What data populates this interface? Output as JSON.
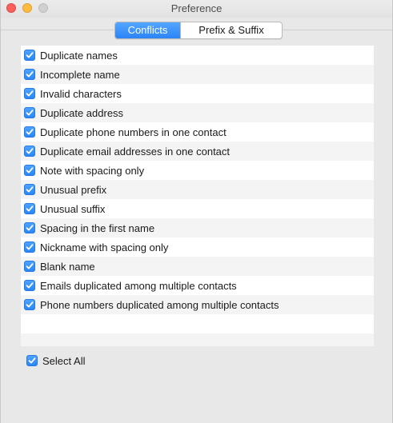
{
  "window": {
    "title": "Preference"
  },
  "tabs": [
    {
      "label": "Conflicts",
      "active": true
    },
    {
      "label": "Prefix & Suffix",
      "active": false
    }
  ],
  "checklist": {
    "items": [
      {
        "label": "Duplicate names",
        "checked": true
      },
      {
        "label": "Incomplete name",
        "checked": true
      },
      {
        "label": "Invalid characters",
        "checked": true
      },
      {
        "label": "Duplicate address",
        "checked": true
      },
      {
        "label": "Duplicate phone numbers in one contact",
        "checked": true
      },
      {
        "label": "Duplicate email addresses in one contact",
        "checked": true
      },
      {
        "label": "Note with spacing only",
        "checked": true
      },
      {
        "label": "Unusual prefix",
        "checked": true
      },
      {
        "label": "Unusual suffix",
        "checked": true
      },
      {
        "label": "Spacing in the first name",
        "checked": true
      },
      {
        "label": "Nickname with spacing only",
        "checked": true
      },
      {
        "label": "Blank name",
        "checked": true
      },
      {
        "label": "Emails duplicated among multiple contacts",
        "checked": true
      },
      {
        "label": "Phone numbers duplicated among multiple contacts",
        "checked": true
      }
    ]
  },
  "select_all": {
    "label": "Select All",
    "checked": true
  },
  "colors": {
    "accent": "#2b84f6",
    "close": "#fc605c",
    "minimize": "#fdbc40",
    "zoom_disabled": "#d0d0d0"
  }
}
